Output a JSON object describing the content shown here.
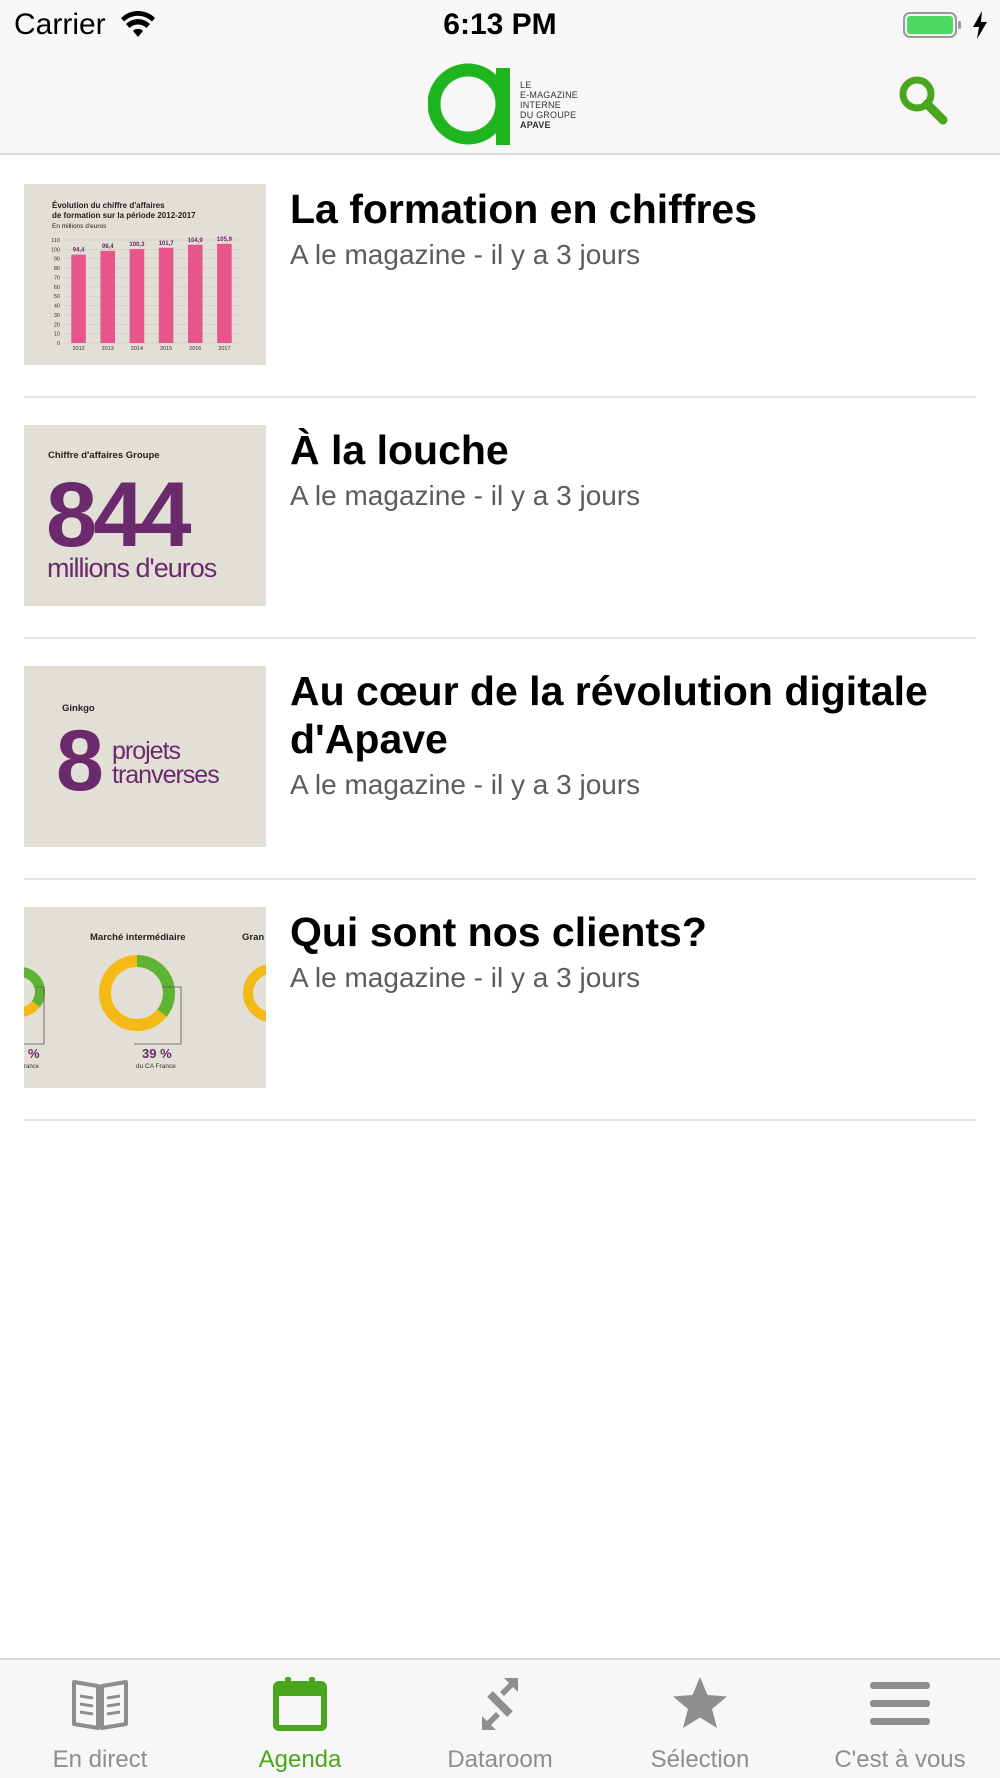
{
  "status_bar": {
    "carrier": "Carrier",
    "time": "6:13 PM",
    "battery_color": "#4cd964"
  },
  "header": {
    "logo_lines": [
      "LE",
      "E-MAGAZINE",
      "INTERNE",
      "DU GROUPE",
      "APAVE"
    ],
    "logo_color": "#1fb51f",
    "search_icon": "search-icon",
    "accent": "#4aa61c"
  },
  "articles": [
    {
      "title": "La formation en chiffres",
      "meta": "A le magazine - il y a 3 jours",
      "thumb": {
        "heading_line1": "Évolution du chiffre d'affaires",
        "heading_line2": "de formation sur la période 2012-2017",
        "subheading": "En millions d'euros",
        "chart_data": {
          "type": "bar",
          "categories": [
            "2012",
            "2013",
            "2014",
            "2015",
            "2016",
            "2017"
          ],
          "values": [
            94.4,
            98.4,
            100.3,
            101.7,
            104.9,
            105.9
          ],
          "value_labels": [
            "94,4",
            "98,4",
            "100,3",
            "101,7",
            "104,9",
            "105,9"
          ],
          "ylim": [
            0,
            110
          ],
          "y_ticks": [
            "0",
            "10",
            "20",
            "30",
            "40",
            "50",
            "60",
            "70",
            "80",
            "90",
            "100",
            "110"
          ],
          "bar_color": "#e8558c"
        }
      }
    },
    {
      "title": "À la louche",
      "meta": "A le magazine - il y a 3 jours",
      "thumb": {
        "label": "Chiffre d'affaires Groupe",
        "big_number": "844",
        "unit": "millions d'euros",
        "color": "#6b2a6b"
      }
    },
    {
      "title": "Au cœur de la révolution digitale d'Apave",
      "meta": "A le magazine - il y a 3 jours",
      "thumb": {
        "label": "Ginkgo",
        "big_number": "8",
        "line1": "projets",
        "line2": "tranverses",
        "color": "#6b2a6b"
      }
    },
    {
      "title": "Qui sont nos clients?",
      "meta": "A le magazine - il y a 3 jours",
      "thumb": {
        "label": "Marché intermédiaire",
        "label_right": "Gran",
        "percent": "39 %",
        "sub": "du CA France",
        "left_percent": "%",
        "left_sub": "rance",
        "donut_yellow": "#f5b915",
        "donut_green": "#5cb334"
      }
    }
  ],
  "tabs": [
    {
      "label": "En direct",
      "icon": "book-icon",
      "active": false
    },
    {
      "label": "Agenda",
      "icon": "calendar-icon",
      "active": true
    },
    {
      "label": "Dataroom",
      "icon": "expand-arrows-icon",
      "active": false
    },
    {
      "label": "Sélection",
      "icon": "star-icon",
      "active": false
    },
    {
      "label": "C'est à vous",
      "icon": "menu-icon",
      "active": false
    }
  ]
}
